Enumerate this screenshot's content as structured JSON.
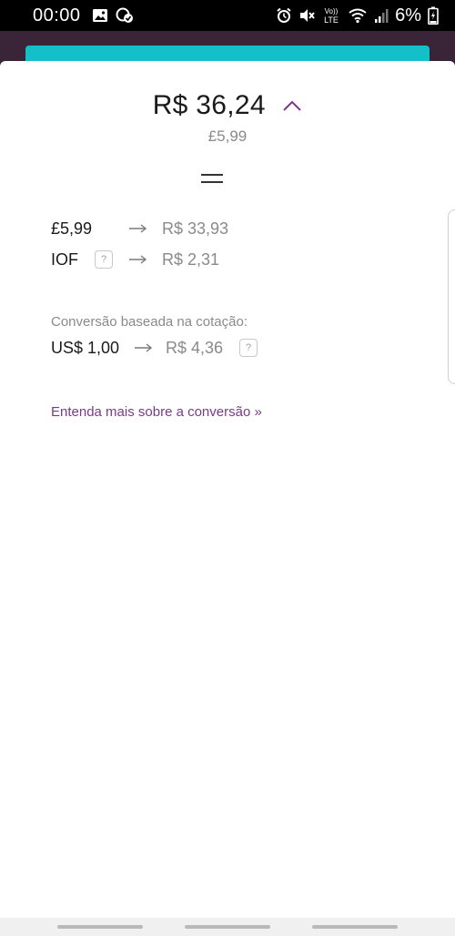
{
  "status_bar": {
    "time": "00:00",
    "battery": "6%",
    "network": "LTE",
    "volte": "Vo))",
    "left_icons": [
      "image-icon",
      "check-circle-icon"
    ],
    "right_icons": [
      "alarm-icon",
      "mute-icon",
      "volte-icon",
      "wifi-icon",
      "signal-icon",
      "battery-icon"
    ]
  },
  "conversion": {
    "total": "R$ 36,24",
    "total_original": "£5,99",
    "lines": [
      {
        "label": "£5,99",
        "value": "R$ 33,93"
      },
      {
        "label": "IOF",
        "value": "R$ 2,31",
        "help": "?"
      }
    ],
    "rate_caption": "Conversão baseada na cotação:",
    "rate": {
      "label": "US$ 1,00",
      "value": "R$ 4,36",
      "help": "?"
    },
    "learn_more": "Entenda mais sobre a conversão »"
  },
  "colors": {
    "accent_purple": "#7a3a8a",
    "teal": "#14c0c8",
    "app_bg": "#3a2438"
  }
}
